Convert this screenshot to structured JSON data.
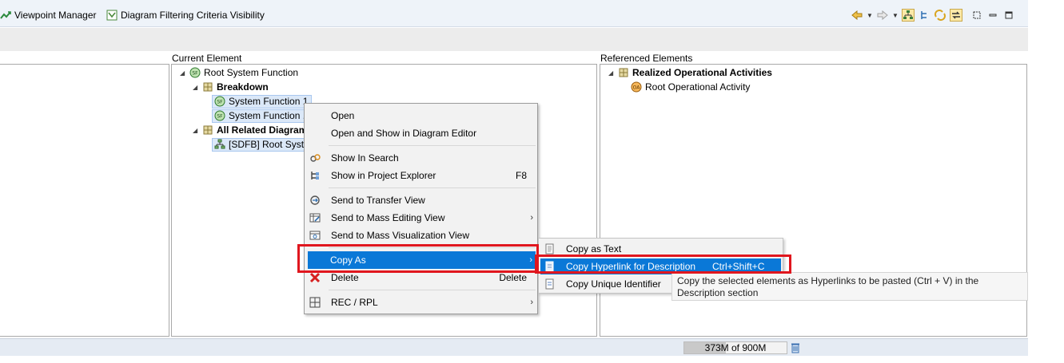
{
  "toolbar": {
    "viewpoint_manager": "Viewpoint Manager",
    "diagram_filtering": "Diagram Filtering Criteria Visibility",
    "right_icons": [
      "back-arrow-icon",
      "forward-arrow-icon",
      "tree-layout-icon",
      "hierarchy-icon",
      "refresh-links-icon",
      "link-with-editor-icon",
      "expand-icon",
      "minimize-icon",
      "maximize-icon"
    ]
  },
  "panes": {
    "current_element_label": "Current Element",
    "referenced_elements_label": "Referenced Elements"
  },
  "tree_current": {
    "root": "Root System Function",
    "breakdown": "Breakdown",
    "sf1": "System Function 1",
    "sf2": "System Function .",
    "all_related": "All Related Diagram",
    "sdfb": "[SDFB] Root Syste"
  },
  "tree_referenced": {
    "realized": "Realized Operational Activities",
    "root_oa": "Root Operational Activity"
  },
  "context_menu": {
    "open": "Open",
    "open_show": "Open and Show in Diagram Editor",
    "show_search": "Show In Search",
    "show_project": "Show in Project Explorer",
    "show_project_acc": "F8",
    "send_transfer": "Send to Transfer View",
    "send_mass_edit": "Send to Mass Editing View",
    "send_mass_vis": "Send to Mass Visualization View",
    "copy_as": "Copy As",
    "delete": "Delete",
    "delete_acc": "Delete",
    "rec_rpl": "REC / RPL"
  },
  "submenu": {
    "copy_text": "Copy as Text",
    "copy_hyperlink": "Copy Hyperlink for Description",
    "copy_hyperlink_acc": "Ctrl+Shift+C",
    "copy_uid": "Copy Unique Identifier"
  },
  "tooltip": {
    "text": "Copy the selected elements as Hyperlinks to be pasted (Ctrl + V) in the Description section"
  },
  "status": {
    "heap": "373M of 900M",
    "heap_used_fraction": 0.41
  },
  "colors": {
    "highlight": "#0a78d7",
    "annotation_red": "#e0161e",
    "toolbar_bg": "#eef3f9"
  }
}
